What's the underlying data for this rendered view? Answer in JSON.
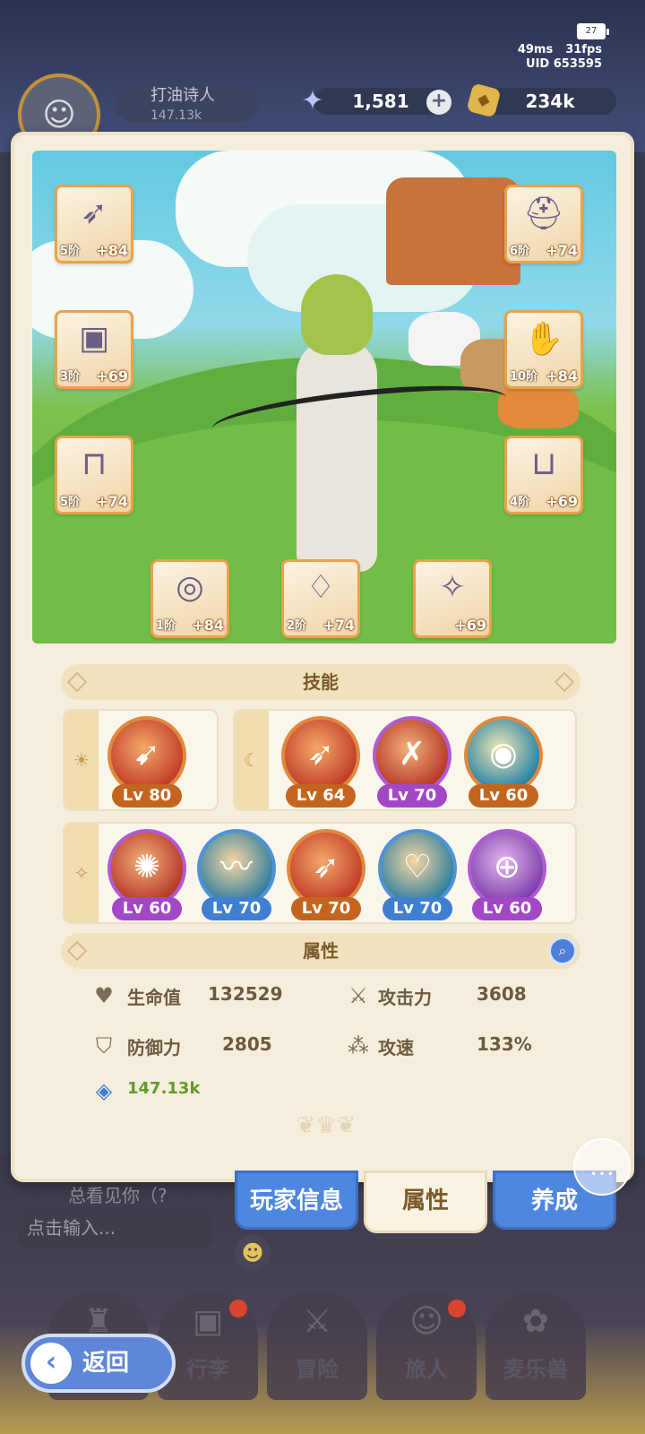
{
  "status_bar": {
    "battery": "27",
    "ping": "49ms",
    "fps": "31fps",
    "uid": "UID 653595"
  },
  "player": {
    "name": "打油诗人",
    "power": "147.13k"
  },
  "resources": {
    "gems": "1,581",
    "gold": "234k"
  },
  "equipment": [
    {
      "slot": "bow",
      "tier": "5阶",
      "bonus": "+84",
      "icon": "bow-icon"
    },
    {
      "slot": "helmet",
      "tier": "6阶",
      "bonus": "+74",
      "icon": "helmet-icon"
    },
    {
      "slot": "armor",
      "tier": "3阶",
      "bonus": "+69",
      "icon": "armor-icon"
    },
    {
      "slot": "gloves",
      "tier": "10阶",
      "bonus": "+84",
      "icon": "gauntlet-icon"
    },
    {
      "slot": "pants",
      "tier": "5阶",
      "bonus": "+74",
      "icon": "pants-icon"
    },
    {
      "slot": "boots",
      "tier": "4阶",
      "bonus": "+69",
      "icon": "boots-icon"
    },
    {
      "slot": "ring",
      "tier": "1阶",
      "bonus": "+84",
      "icon": "ring-icon"
    },
    {
      "slot": "necklace",
      "tier": "2阶",
      "bonus": "+74",
      "icon": "necklace-icon"
    },
    {
      "slot": "accessory",
      "tier": "",
      "bonus": "+69",
      "icon": "pendant-icon"
    }
  ],
  "skills_section": {
    "title": "技能"
  },
  "skills": {
    "sun": [
      {
        "level": "Lv 80",
        "color": "orange"
      }
    ],
    "moon": [
      {
        "level": "Lv 64",
        "color": "orange"
      },
      {
        "level": "Lv 70",
        "color": "purple"
      },
      {
        "level": "Lv 60",
        "color": "orange"
      }
    ],
    "star": [
      {
        "level": "Lv 60",
        "color": "purple"
      },
      {
        "level": "Lv 70",
        "color": "blue"
      },
      {
        "level": "Lv 70",
        "color": "orange"
      },
      {
        "level": "Lv 70",
        "color": "blue"
      },
      {
        "level": "Lv 60",
        "color": "purple"
      }
    ]
  },
  "attributes_section": {
    "title": "属性"
  },
  "attributes": {
    "hp": {
      "label": "生命值",
      "value": "132529"
    },
    "attack": {
      "label": "攻击力",
      "value": "3608"
    },
    "defense": {
      "label": "防御力",
      "value": "2805"
    },
    "atk_speed": {
      "label": "攻速",
      "value": "133%"
    },
    "power": {
      "value": "147.13k"
    }
  },
  "tabs": {
    "player_info": "玩家信息",
    "attributes": "属性",
    "training": "养成"
  },
  "chat": {
    "last_message": "总看见你（?",
    "input_placeholder": "点击输入..."
  },
  "nav": {
    "back": "返回",
    "items": [
      "行李",
      "冒险",
      "旅人",
      "麦乐兽"
    ]
  },
  "colors": {
    "accent_orange": "#e9a24a",
    "tab_blue": "#4f86e0",
    "panel": "#f6eedd",
    "power_green": "#5f9c2d"
  }
}
